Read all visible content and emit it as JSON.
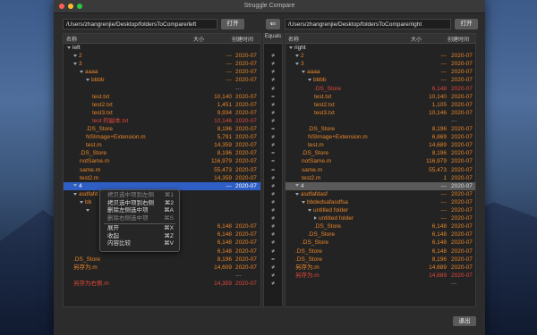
{
  "window": {
    "title": "Struggle Compare"
  },
  "left": {
    "path": "/Users/zhangrenjie/Desktop/foldersToCompare/left",
    "open_label": "打开"
  },
  "right": {
    "path": "/Users/zhangrenjie/Desktop/foldersToCompare/right",
    "open_label": "打开"
  },
  "columns": {
    "name": "名称",
    "size": "大小",
    "date": "创建时间",
    "equals": "Equals"
  },
  "colors": {
    "orange": "#e8862a",
    "red": "#e0483c",
    "white": "#dddddd",
    "gray": "#888888"
  },
  "left_rows": [
    {
      "indent": 0,
      "arrow": "open",
      "name": "left",
      "size": "",
      "date": "",
      "color": "white"
    },
    {
      "indent": 1,
      "arrow": "open",
      "name": "2",
      "size": "---",
      "date": "2020-07",
      "color": "orange"
    },
    {
      "indent": 1,
      "arrow": "open",
      "name": "3",
      "size": "---",
      "date": "2020-07",
      "color": "orange"
    },
    {
      "indent": 2,
      "arrow": "open",
      "name": "aaaa",
      "size": "---",
      "date": "2020-07",
      "color": "orange"
    },
    {
      "indent": 3,
      "arrow": "open",
      "name": "bbbb",
      "size": "---",
      "date": "2020-07",
      "color": "orange"
    },
    {
      "indent": 4,
      "arrow": "",
      "name": "",
      "size": "",
      "date": "---",
      "color": "gray"
    },
    {
      "indent": 4,
      "arrow": "",
      "name": "test.txt",
      "size": "10,140",
      "date": "2020-07",
      "color": "orange"
    },
    {
      "indent": 4,
      "arrow": "",
      "name": "test2.txt",
      "size": "1,451",
      "date": "2020-07",
      "color": "orange"
    },
    {
      "indent": 4,
      "arrow": "",
      "name": "test3.txt",
      "size": "9,934",
      "date": "2020-07",
      "color": "orange"
    },
    {
      "indent": 4,
      "arrow": "",
      "name": "test 的副本.txt",
      "size": "10,146",
      "date": "2020-07",
      "color": "red"
    },
    {
      "indent": 3,
      "arrow": "",
      "name": ".DS_Store",
      "size": "8,196",
      "date": "2020-07",
      "color": "orange"
    },
    {
      "indent": 3,
      "arrow": "",
      "name": "NSImage+Extension.m",
      "size": "5,791",
      "date": "2020-07",
      "color": "orange"
    },
    {
      "indent": 3,
      "arrow": "",
      "name": "test.m",
      "size": "14,359",
      "date": "2020-07",
      "color": "orange"
    },
    {
      "indent": 2,
      "arrow": "",
      "name": ".DS_Store",
      "size": "8,196",
      "date": "2020-07",
      "color": "orange"
    },
    {
      "indent": 2,
      "arrow": "",
      "name": "notSame.m",
      "size": "116,979",
      "date": "2020-07",
      "color": "orange"
    },
    {
      "indent": 2,
      "arrow": "",
      "name": "same.m",
      "size": "55,473",
      "date": "2020-07",
      "color": "orange"
    },
    {
      "indent": 2,
      "arrow": "",
      "name": "test2.m",
      "size": "14,359",
      "date": "2020-07",
      "color": "orange"
    },
    {
      "indent": 1,
      "arrow": "open",
      "name": "4",
      "size": "---",
      "date": "2020-07",
      "color": "white",
      "selected": true
    },
    {
      "indent": 1,
      "arrow": "open",
      "name": "asdfafd",
      "size": "",
      "date": "",
      "color": "orange"
    },
    {
      "indent": 2,
      "arrow": "open",
      "name": "bb",
      "size": "",
      "date": "",
      "color": "orange"
    },
    {
      "indent": 3,
      "arrow": "open",
      "name": "",
      "size": "",
      "date": "",
      "color": "orange"
    },
    {
      "indent": 4,
      "arrow": "",
      "name": "",
      "size": "",
      "date": "",
      "color": "orange"
    },
    {
      "indent": 3,
      "arrow": "",
      "name": "",
      "size": "6,148",
      "date": "2020-07",
      "color": "orange"
    },
    {
      "indent": 3,
      "arrow": "",
      "name": "",
      "size": "6,148",
      "date": "2020-07",
      "color": "orange"
    },
    {
      "indent": 2,
      "arrow": "",
      "name": "",
      "size": "6,148",
      "date": "2020-07",
      "color": "orange"
    },
    {
      "indent": 2,
      "arrow": "",
      "name": "",
      "size": "6,148",
      "date": "2020-07",
      "color": "orange"
    },
    {
      "indent": 1,
      "arrow": "",
      "name": ".DS_Store",
      "size": "8,196",
      "date": "2020-07",
      "color": "orange"
    },
    {
      "indent": 1,
      "arrow": "",
      "name": "另存为.m",
      "size": "14,609",
      "date": "2020-07",
      "color": "orange"
    },
    {
      "indent": 0,
      "arrow": "",
      "name": "",
      "size": "",
      "date": "---",
      "color": "gray"
    },
    {
      "indent": 1,
      "arrow": "",
      "name": "另存为右侧.m",
      "size": "14,359",
      "date": "2020-07",
      "color": "red"
    }
  ],
  "right_rows": [
    {
      "indent": 0,
      "arrow": "open",
      "name": "right",
      "size": "",
      "date": "",
      "color": "white"
    },
    {
      "indent": 1,
      "arrow": "open",
      "name": "2",
      "size": "---",
      "date": "2020-07",
      "color": "orange"
    },
    {
      "indent": 1,
      "arrow": "open",
      "name": "3",
      "size": "---",
      "date": "2020-07",
      "color": "orange"
    },
    {
      "indent": 2,
      "arrow": "open",
      "name": "aaaa",
      "size": "---",
      "date": "2020-07",
      "color": "orange"
    },
    {
      "indent": 3,
      "arrow": "open",
      "name": "bbbb",
      "size": "---",
      "date": "2020-07",
      "color": "orange"
    },
    {
      "indent": 4,
      "arrow": "",
      "name": ".DS_Store",
      "size": "6,148",
      "date": "2020-07",
      "color": "red"
    },
    {
      "indent": 4,
      "arrow": "",
      "name": "test.txt",
      "size": "10,140",
      "date": "2020-07",
      "color": "orange"
    },
    {
      "indent": 4,
      "arrow": "",
      "name": "test2.txt",
      "size": "1,105",
      "date": "2020-07",
      "color": "orange"
    },
    {
      "indent": 4,
      "arrow": "",
      "name": "test3.txt",
      "size": "10,146",
      "date": "2020-07",
      "color": "orange"
    },
    {
      "indent": 4,
      "arrow": "",
      "name": "",
      "size": "",
      "date": "---",
      "color": "gray"
    },
    {
      "indent": 3,
      "arrow": "",
      "name": ".DS_Store",
      "size": "8,196",
      "date": "2020-07",
      "color": "orange"
    },
    {
      "indent": 3,
      "arrow": "",
      "name": "NSImage+Extension.m",
      "size": "6,869",
      "date": "2020-07",
      "color": "orange"
    },
    {
      "indent": 3,
      "arrow": "",
      "name": "test.m",
      "size": "14,689",
      "date": "2020-07",
      "color": "orange"
    },
    {
      "indent": 2,
      "arrow": "",
      "name": ".DS_Store",
      "size": "8,196",
      "date": "2020-07",
      "color": "orange"
    },
    {
      "indent": 2,
      "arrow": "",
      "name": "notSame.m",
      "size": "116,979",
      "date": "2020-07",
      "color": "orange"
    },
    {
      "indent": 2,
      "arrow": "",
      "name": "same.m",
      "size": "55,473",
      "date": "2020-07",
      "color": "orange"
    },
    {
      "indent": 2,
      "arrow": "",
      "name": "test2.m",
      "size": "1",
      "date": "2020-07",
      "color": "orange"
    },
    {
      "indent": 1,
      "arrow": "open",
      "name": "4",
      "size": "---",
      "date": "2020-07",
      "color": "white",
      "gray": true
    },
    {
      "indent": 1,
      "arrow": "open",
      "name": "asdfafdasf",
      "size": "---",
      "date": "2020-07",
      "color": "orange"
    },
    {
      "indent": 2,
      "arrow": "open",
      "name": "bbdedsafasdfsa",
      "size": "---",
      "date": "2020-07",
      "color": "orange"
    },
    {
      "indent": 3,
      "arrow": "open",
      "name": "untitled folder",
      "size": "---",
      "date": "2020-07",
      "color": "orange"
    },
    {
      "indent": 4,
      "arrow": "closed",
      "name": "untitled folder",
      "size": "---",
      "date": "2020-07",
      "color": "orange"
    },
    {
      "indent": 4,
      "arrow": "",
      "name": ".DS_Store",
      "size": "6,148",
      "date": "2020-07",
      "color": "orange"
    },
    {
      "indent": 3,
      "arrow": "",
      "name": ".DS_Store",
      "size": "6,148",
      "date": "2020-07",
      "color": "orange"
    },
    {
      "indent": 2,
      "arrow": "",
      "name": ".DS_Store",
      "size": "6,148",
      "date": "2020-07",
      "color": "orange"
    },
    {
      "indent": 1,
      "arrow": "",
      "name": ".DS_Store",
      "size": "6,148",
      "date": "2020-07",
      "color": "orange"
    },
    {
      "indent": 1,
      "arrow": "",
      "name": ".DS_Store",
      "size": "8,196",
      "date": "2020-07",
      "color": "orange"
    },
    {
      "indent": 1,
      "arrow": "",
      "name": "另存为.m",
      "size": "14,689",
      "date": "2020-07",
      "color": "orange"
    },
    {
      "indent": 1,
      "arrow": "",
      "name": "另存为.m",
      "size": "14,689",
      "date": "2020-07",
      "color": "red"
    },
    {
      "indent": 0,
      "arrow": "",
      "name": "",
      "size": "",
      "date": "---",
      "color": "gray"
    }
  ],
  "equals": [
    "",
    "≠",
    "≠",
    "≠",
    "≠",
    "≠",
    "=",
    "≠",
    "≠",
    "≠",
    "=",
    "≠",
    "≠",
    "=",
    "=",
    "=",
    "≠",
    "≠",
    "≠",
    "≠",
    "≠",
    "≠",
    "≠",
    "≠",
    "≠",
    "≠",
    "=",
    "≠",
    "≠",
    "≠"
  ],
  "context_menu": [
    {
      "label": "拷贝选中项到左侧",
      "key": "⌘1",
      "disabled": true
    },
    {
      "label": "拷贝选中项到右侧",
      "key": "⌘2",
      "disabled": false
    },
    {
      "label": "删除左侧选中项",
      "key": "⌘A",
      "disabled": false
    },
    {
      "label": "删除右侧选中项",
      "key": "⌘S",
      "disabled": true
    },
    {
      "sep": true
    },
    {
      "label": "展开",
      "key": "⌘X",
      "disabled": false
    },
    {
      "label": "收起",
      "key": "⌘Z",
      "disabled": false
    },
    {
      "label": "内容比较",
      "key": "⌘V",
      "disabled": false
    }
  ],
  "footer": {
    "exit_label": "退出"
  }
}
